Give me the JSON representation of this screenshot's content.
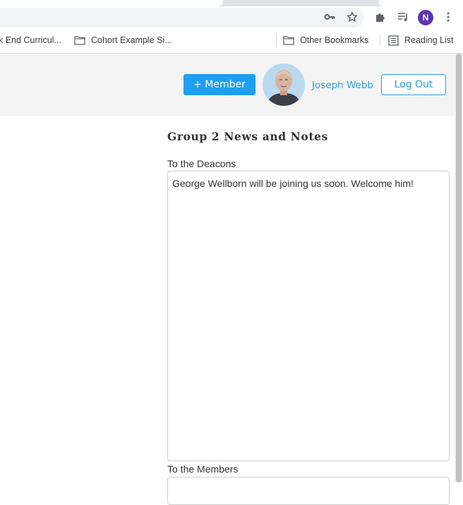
{
  "browser": {
    "bookmarks": [
      {
        "label": "k End Curricul..."
      },
      {
        "label": "Cohort Example Si..."
      },
      {
        "label": "Other Bookmarks"
      },
      {
        "label": "Reading List"
      }
    ],
    "profile_initial": "N",
    "icons": [
      "key-icon",
      "star-icon",
      "extensions-icon",
      "media-icon",
      "menu-icon",
      "folder-icon",
      "reading-list-icon"
    ]
  },
  "header": {
    "add_member_label": "+ Member",
    "user_name": "Joseph Webb",
    "logout_label": "Log Out"
  },
  "main": {
    "title": "Group 2 News and Notes",
    "deacons_label": "To the Deacons",
    "deacons_text": "George Wellborn will be joining us soon. Welcome him!",
    "members_label": "To the Members",
    "members_text": ""
  },
  "colors": {
    "accent": "#1e9ff2",
    "link": "#2e9fd8",
    "header_bg": "#f4f4f4",
    "profile_badge": "#5e35b1"
  }
}
